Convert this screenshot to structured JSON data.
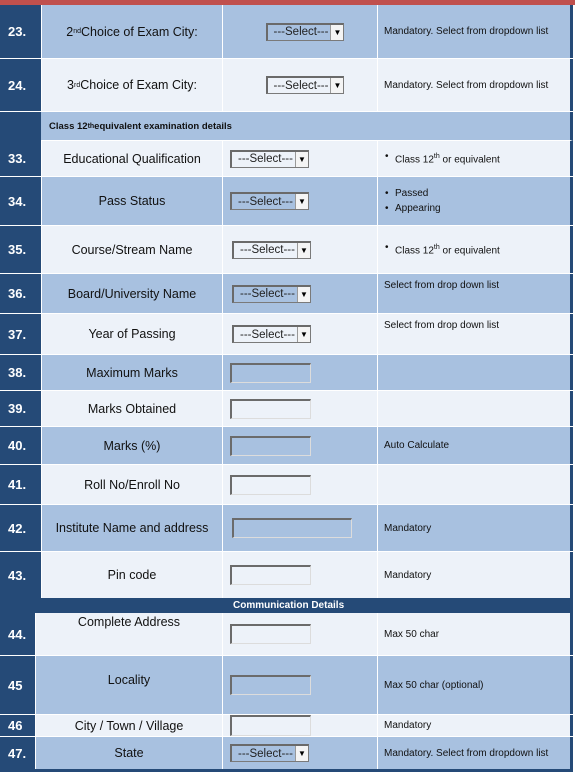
{
  "rows_top": [
    {
      "num": "23.",
      "label_pre": "2",
      "label_sup": "nd",
      "label_post": " Choice of Exam City:",
      "control": "select",
      "value": "---Select---",
      "note": "Mandatory. Select from dropdown list"
    },
    {
      "num": "24.",
      "label_pre": "3",
      "label_sup": "rd",
      "label_post": " Choice of Exam City:",
      "control": "select",
      "value": "---Select---",
      "note": "Mandatory. Select from dropdown list"
    }
  ],
  "section_class12": {
    "pre": "Class 12",
    "sup": "th",
    "post": " equivalent examination details"
  },
  "rows_class12": [
    {
      "num": "33.",
      "label": "Educational Qualification",
      "value": "---Select---",
      "note_bullets": [
        {
          "pre": "Class 12",
          "sup": "th",
          "post": " or equivalent"
        }
      ]
    },
    {
      "num": "34.",
      "label": "Pass Status",
      "value": "---Select---",
      "note_bullets": [
        {
          "pre": "Passed"
        },
        {
          "pre": "Appearing"
        }
      ]
    },
    {
      "num": "35.",
      "label": "Course/Stream Name",
      "value": "---Select---",
      "note_bullets": [
        {
          "pre": "Class 12",
          "sup": "th",
          "post": " or equivalent"
        }
      ]
    },
    {
      "num": "36.",
      "label": "Board/University Name",
      "value": "---Select---",
      "note": "Select from drop down list"
    },
    {
      "num": "37.",
      "label": "Year of Passing",
      "value": "---Select---",
      "note": "Select from drop down list"
    },
    {
      "num": "38.",
      "label": "Maximum Marks",
      "input_value": "",
      "note": ""
    },
    {
      "num": "39.",
      "label": "Marks Obtained",
      "input_value": "",
      "note": ""
    },
    {
      "num": "40.",
      "label": "Marks (%)",
      "input_value": "",
      "note": "Auto Calculate"
    },
    {
      "num": "41.",
      "label": "Roll No/Enroll No",
      "input_value": "",
      "note": ""
    },
    {
      "num": "42.",
      "label": "Institute Name and address",
      "input_value": "",
      "note": "Mandatory"
    },
    {
      "num": "43.",
      "label": "Pin code",
      "input_value": "",
      "note": "Mandatory"
    }
  ],
  "section_comm": "Communication Details",
  "rows_comm": [
    {
      "num": "44.",
      "label": "Complete Address",
      "input_value": "",
      "note": "Max 50 char"
    },
    {
      "num": "45",
      "label": "Locality",
      "input_value": "",
      "note": "Max 50 char (optional)"
    },
    {
      "num": "46",
      "label": "City / Town / Village",
      "input_value": "",
      "note": "Mandatory"
    },
    {
      "num": "47.",
      "label": "State",
      "value": "---Select---",
      "note": "Mandatory. Select from dropdown list"
    }
  ],
  "dropdown_arrow_icon": "▼",
  "colors": {
    "header_red": "#c0504d",
    "navy": "#254a77",
    "row_blue": "#a8c1e0",
    "row_light": "#edf2f9"
  }
}
